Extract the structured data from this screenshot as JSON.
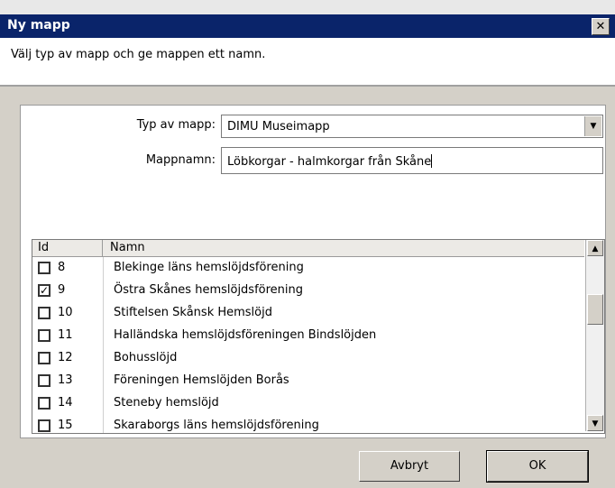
{
  "window": {
    "title": "Ny mapp",
    "close_glyph": "✕"
  },
  "header": {
    "instruction": "Välj typ av mapp och ge mappen ett namn."
  },
  "form": {
    "type_label": "Typ av mapp:",
    "type_value": "DIMU Museimapp",
    "name_label": "Mappnamn:",
    "name_value": "Löbkorgar - halmkorgar från Skåne"
  },
  "grid": {
    "columns": [
      "Id",
      "Namn"
    ],
    "rows": [
      {
        "checked": false,
        "id": "8",
        "name": "Blekinge läns hemslöjdsförening"
      },
      {
        "checked": true,
        "id": "9",
        "name": "Östra Skånes hemslöjdsförening"
      },
      {
        "checked": false,
        "id": "10",
        "name": "Stiftelsen Skånsk Hemslöjd"
      },
      {
        "checked": false,
        "id": "11",
        "name": "Halländska hemslöjdsföreningen Bindslöjden"
      },
      {
        "checked": false,
        "id": "12",
        "name": "Bohusslöjd"
      },
      {
        "checked": false,
        "id": "13",
        "name": "Föreningen Hemslöjden Borås"
      },
      {
        "checked": false,
        "id": "14",
        "name": "Steneby hemslöjd"
      },
      {
        "checked": false,
        "id": "15",
        "name": "Skaraborgs läns hemslöjdsförening"
      }
    ]
  },
  "buttons": {
    "cancel": "Avbryt",
    "ok": "OK"
  }
}
